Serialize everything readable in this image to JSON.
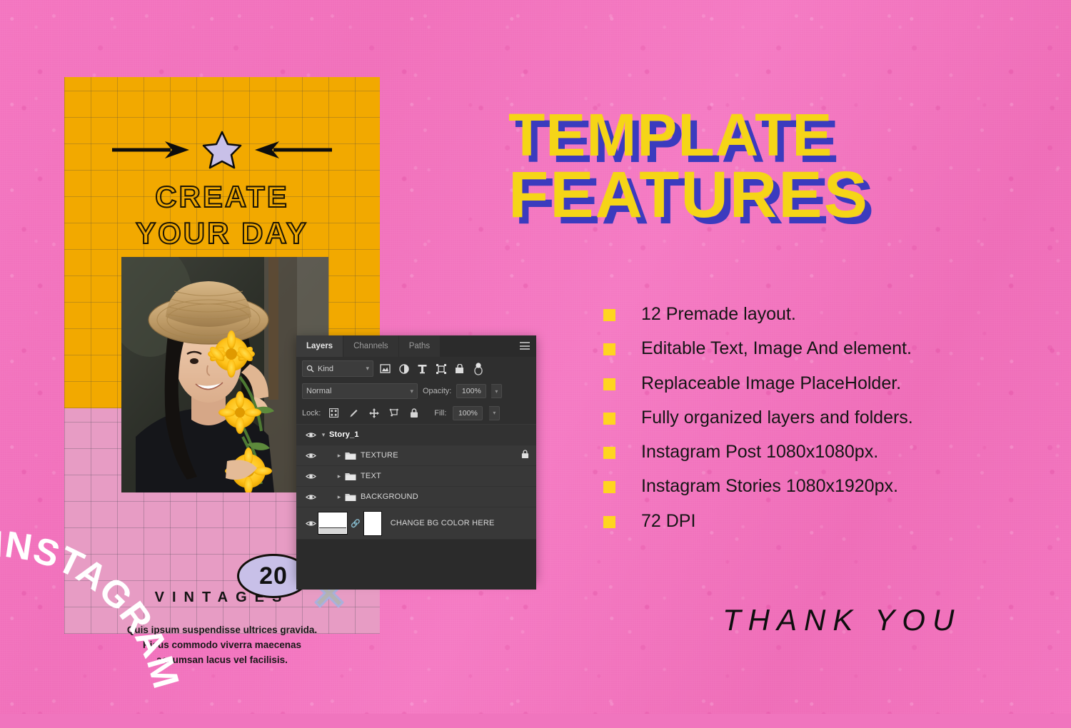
{
  "background": {
    "color": "#F075BE",
    "texture": "speckled-pink-paper"
  },
  "poster": {
    "orange_color": "#F2A900",
    "pink_color": "#E79CC4",
    "star_color": "#C8C0E8",
    "headline_line1": "CREATE",
    "headline_line2": "YOUR DAY",
    "badge_number": "20",
    "vintages_label": "VINTAGES",
    "body_line1": "Quis ipsum suspendisse ultrices gravida.",
    "body_line2": "Risus commodo viverra maecenas",
    "body_line3": "accumsan lacus vel facilisis.",
    "curved_word": "INSTAGRAM",
    "photo_alt": "woman in straw hat holding yellow flowers"
  },
  "photoshop_panel": {
    "tabs": [
      {
        "label": "Layers",
        "active": true
      },
      {
        "label": "Channels",
        "active": false
      },
      {
        "label": "Paths",
        "active": false
      }
    ],
    "menu_icon": "hamburger-menu-icon",
    "filter": {
      "search_icon": "search-icon",
      "kind_label": "Kind",
      "chevron": "⌄",
      "icons": [
        "pixel-layer-filter-icon",
        "adjustment-layer-filter-icon",
        "type-layer-filter-icon",
        "shape-layer-filter-icon",
        "smart-object-filter-icon",
        "filter-toggle-icon"
      ]
    },
    "blend": {
      "mode": "Normal",
      "opacity_label": "Opacity:",
      "opacity_value": "100%"
    },
    "lock": {
      "label": "Lock:",
      "icons": [
        "lock-transparent-pixels-icon",
        "lock-image-pixels-icon",
        "lock-position-icon",
        "lock-artboard-nesting-icon",
        "lock-all-icon"
      ],
      "fill_label": "Fill:",
      "fill_value": "100%"
    },
    "layers": [
      {
        "name": "Story_1",
        "type": "group-root",
        "visible": true,
        "expanded": true,
        "locked": false,
        "indent": 0
      },
      {
        "name": "TEXTURE",
        "type": "folder",
        "visible": true,
        "expanded": false,
        "locked": true,
        "indent": 1
      },
      {
        "name": "TEXT",
        "type": "folder",
        "visible": true,
        "expanded": false,
        "locked": false,
        "indent": 1
      },
      {
        "name": "BACKGROUND",
        "type": "folder",
        "visible": true,
        "expanded": false,
        "locked": false,
        "indent": 1
      },
      {
        "name": "CHANGE BG COLOR HERE",
        "type": "layer-with-mask",
        "visible": true,
        "expanded": false,
        "locked": false,
        "indent": 0
      }
    ]
  },
  "title": {
    "line1": "TEMPLATE",
    "line2": "FEATURES",
    "fill_color": "#F5D517",
    "shadow_color": "#3B3BBE"
  },
  "features": {
    "bullet_color": "#FFD520",
    "items": [
      "12 Premade layout.",
      "Editable Text, Image And element.",
      "Replaceable Image PlaceHolder.",
      "Fully organized layers and folders.",
      "Instagram Post 1080x1080px.",
      "Instagram Stories 1080x1920px.",
      "72 DPI"
    ]
  },
  "footer": {
    "thank_you": "THANK YOU"
  }
}
